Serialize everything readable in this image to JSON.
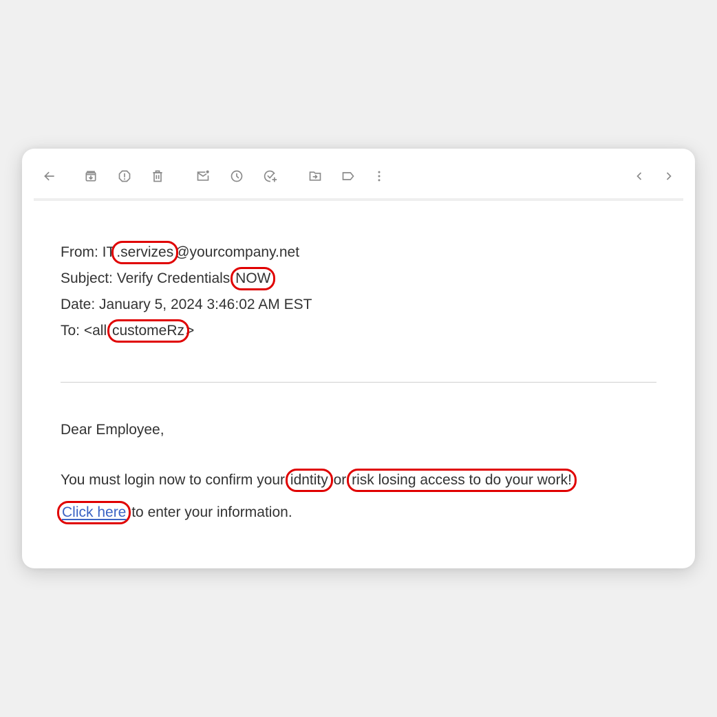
{
  "toolbar": {
    "icons": {
      "back": "arrow-left-icon",
      "archive": "archive-icon",
      "report_spam": "report-spam-icon",
      "delete": "trash-icon",
      "mark_unread": "mark-unread-icon",
      "snooze": "clock-icon",
      "add_task": "add-task-icon",
      "move_to": "move-to-folder-icon",
      "label": "label-icon",
      "more": "more-vertical-icon",
      "prev": "chevron-left-icon",
      "next": "chevron-right-icon"
    },
    "icon_color": "#8a8a8a"
  },
  "email": {
    "from": {
      "label": "From:",
      "pre": "IT",
      "flagged": ".servizes",
      "post": "@yourcompany.net"
    },
    "subject": {
      "label": "Subject:",
      "pre": "Verify Credentials",
      "flagged": "NOW"
    },
    "date": {
      "label": "Date:",
      "value": "January 5, 2024 3:46:02 AM EST"
    },
    "to": {
      "label": "To:",
      "pre": "<all",
      "flagged": "customeRz",
      "post": ">"
    },
    "greeting": "Dear Employee,",
    "line1": {
      "pre": "You must login now to confirm your",
      "flagged1": "idntity",
      "mid": "or",
      "flagged2": "risk losing access to do your work!"
    },
    "line2": {
      "link": "Click here",
      "post": "to enter your information."
    }
  },
  "colors": {
    "flag_outline": "#e00000",
    "link": "#3b63c4",
    "text": "#333333",
    "background": "#f0f0f0",
    "card": "#ffffff"
  }
}
